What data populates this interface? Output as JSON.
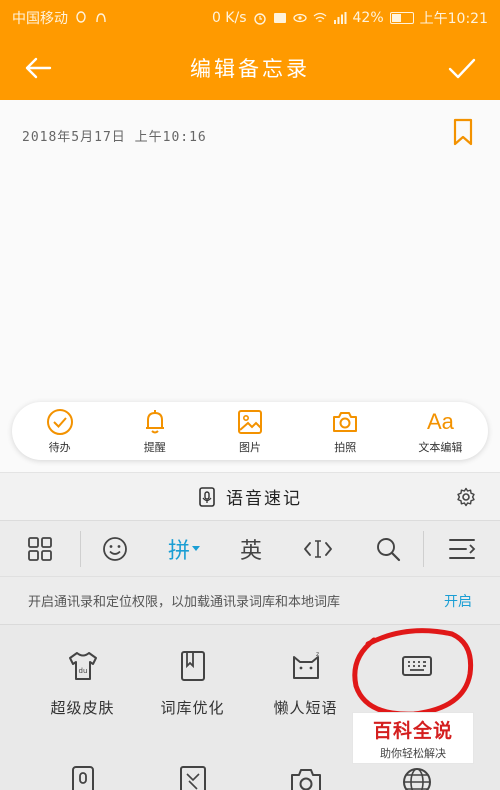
{
  "status_bar": {
    "carrier": "中国移动",
    "network_speed": "0 K/s",
    "battery": "42%",
    "battery_level": 0.42,
    "time": "上午10:21"
  },
  "header": {
    "title": "编辑备忘录"
  },
  "note": {
    "date": "2018年5月17日 上午10:16"
  },
  "tools": [
    {
      "label": "待办",
      "icon": "check-circle-icon"
    },
    {
      "label": "提醒",
      "icon": "bell-icon"
    },
    {
      "label": "图片",
      "icon": "image-icon"
    },
    {
      "label": "拍照",
      "icon": "camera-icon"
    },
    {
      "label": "文本编辑",
      "icon": "text-format-icon",
      "glyph": "Aa"
    }
  ],
  "voice": {
    "label": "语音速记"
  },
  "keyboard": {
    "pinyin": "拼",
    "english": "英"
  },
  "notice": {
    "text": "开启通讯录和定位权限，以加载通讯录词库和本地词库",
    "action": "开启"
  },
  "panel": {
    "items": [
      {
        "label": "超级皮肤",
        "icon": "tshirt-icon"
      },
      {
        "label": "词库优化",
        "icon": "book-icon"
      },
      {
        "label": "懒人短语",
        "icon": "cat-icon"
      },
      {
        "label": "",
        "icon": "keyboard-icon"
      }
    ]
  },
  "watermark": {
    "line1": "百科全说",
    "line2": "助你轻松解决"
  },
  "colors": {
    "accent": "#ff9a00",
    "tool_icon": "#f39200",
    "link": "#1a9ed4",
    "annotation": "#e01818"
  }
}
